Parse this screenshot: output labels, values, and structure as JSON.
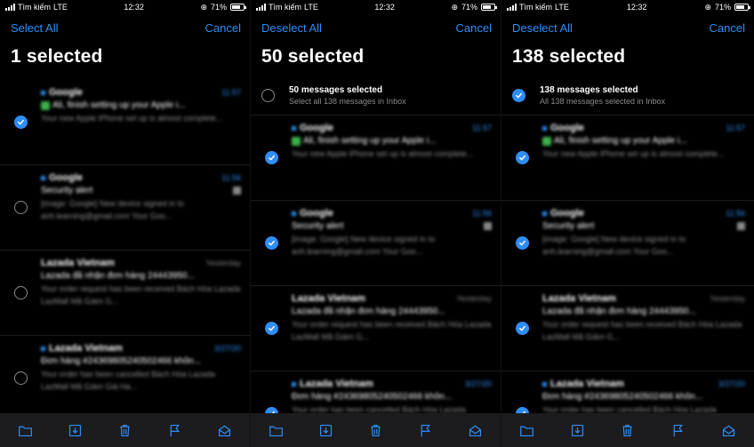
{
  "status": {
    "carrier": "Tìm kiếm",
    "network": "LTE",
    "time": "12:32",
    "battery": "71%"
  },
  "colors": {
    "accent": "#2f8ef6",
    "background": "#000000",
    "toolbar": "#1c1c1e"
  },
  "panels": [
    {
      "left_button": "Select All",
      "right_button": "Cancel",
      "title": "1 selected",
      "messages": [
        {
          "selected": true,
          "unread": true,
          "sender": "Google",
          "time": "11:57",
          "subject": "Ali, finish setting up your Apple i...",
          "preview": "Your new Apple iPhone set up is almost complete...",
          "has_icon": true,
          "attachment": false
        },
        {
          "selected": false,
          "unread": true,
          "sender": "Google",
          "time": "11:56",
          "subject": "Security alert",
          "preview": "[image: Google] New device signed in to anh.learning@gmail.com Your Goo...",
          "has_icon": false,
          "attachment": true
        },
        {
          "selected": false,
          "unread": false,
          "sender": "Lazada Vietnam",
          "time": "Yesterday",
          "subject": "Lazada đã nhận đơn hàng 24443950...",
          "preview": "Your order request has been received Bách Hóa Lazada LazMall Mã Giảm G...",
          "has_icon": false,
          "attachment": false
        },
        {
          "selected": false,
          "unread": true,
          "sender": "Lazada Vietnam",
          "time": "3/27/20",
          "subject": "Đơn hàng #24369805240502466 khôn...",
          "preview": "Your order has been cancelled Bách Hóa Lazada LazMall Mã Giảm Giá Ha...",
          "has_icon": false,
          "attachment": false
        }
      ]
    },
    {
      "left_button": "Deselect All",
      "right_button": "Cancel",
      "title": "50 selected",
      "all_row": {
        "selected": false,
        "main": "50 messages selected",
        "sub": "Select all 138 messages in Inbox"
      },
      "messages": [
        {
          "selected": true,
          "unread": true,
          "sender": "Google",
          "time": "11:57",
          "subject": "Ali, finish setting up your Apple i...",
          "preview": "Your new Apple iPhone set up is almost complete...",
          "has_icon": true,
          "attachment": false
        },
        {
          "selected": true,
          "unread": true,
          "sender": "Google",
          "time": "11:56",
          "subject": "Security alert",
          "preview": "[image: Google] New device signed in to anh.learning@gmail.com Your Goo...",
          "has_icon": false,
          "attachment": true
        },
        {
          "selected": true,
          "unread": false,
          "sender": "Lazada Vietnam",
          "time": "Yesterday",
          "subject": "Lazada đã nhận đơn hàng 24443950...",
          "preview": "Your order request has been received Bách Hóa Lazada LazMall Mã Giảm G...",
          "has_icon": false,
          "attachment": false
        },
        {
          "selected": true,
          "unread": true,
          "sender": "Lazada Vietnam",
          "time": "3/27/20",
          "subject": "Đơn hàng #24369805240502466 khôn...",
          "preview": "Your order has been cancelled Bách Hóa Lazada LazMall Mã Giảm Giá Ha...",
          "has_icon": false,
          "attachment": false
        }
      ]
    },
    {
      "left_button": "Deselect All",
      "right_button": "Cancel",
      "title": "138 selected",
      "all_row": {
        "selected": true,
        "main": "138 messages selected",
        "sub": "All 138 messages selected in Inbox"
      },
      "messages": [
        {
          "selected": true,
          "unread": true,
          "sender": "Google",
          "time": "11:57",
          "subject": "Ali, finish setting up your Apple i...",
          "preview": "Your new Apple iPhone set up is almost complete...",
          "has_icon": true,
          "attachment": false
        },
        {
          "selected": true,
          "unread": true,
          "sender": "Google",
          "time": "11:56",
          "subject": "Security alert",
          "preview": "[image: Google] New device signed in to anh.learning@gmail.com Your Goo...",
          "has_icon": false,
          "attachment": true
        },
        {
          "selected": true,
          "unread": false,
          "sender": "Lazada Vietnam",
          "time": "Yesterday",
          "subject": "Lazada đã nhận đơn hàng 24443950...",
          "preview": "Your order request has been received Bách Hóa Lazada LazMall Mã Giảm G...",
          "has_icon": false,
          "attachment": false
        },
        {
          "selected": true,
          "unread": true,
          "sender": "Lazada Vietnam",
          "time": "3/27/20",
          "subject": "Đơn hàng #24369805240502466 khôn...",
          "preview": "Your order has been cancelled Bách Hóa Lazada LazMall Mã Giảm Giá Ha...",
          "has_icon": false,
          "attachment": false
        }
      ]
    }
  ],
  "toolbar_icons": [
    "folder-icon",
    "archive-icon",
    "trash-icon",
    "flag-icon",
    "mark-read-icon"
  ]
}
